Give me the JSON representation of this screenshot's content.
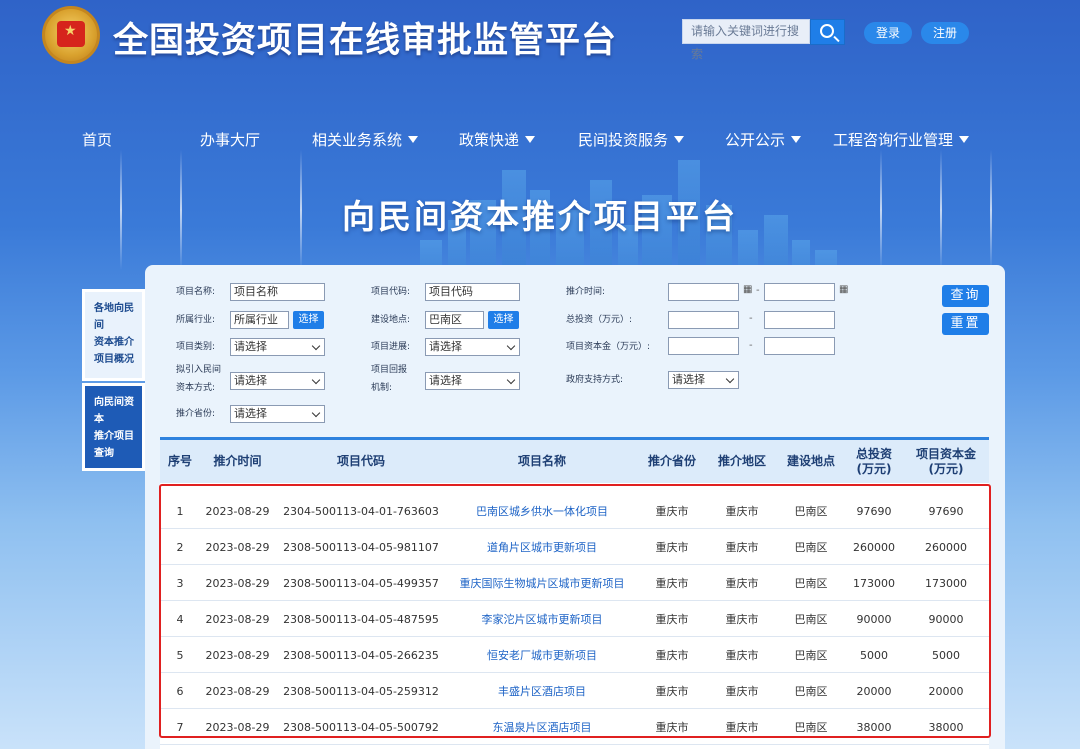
{
  "header": {
    "site_title": "全国投资项目在线审批监管平台",
    "search_placeholder": "请输入关键词进行搜索",
    "login": "登录",
    "register": "注册"
  },
  "nav": [
    "首页",
    "办事大厅",
    "相关业务系统",
    "政策快递",
    "民间投资服务",
    "公开公示",
    "工程咨询行业管理"
  ],
  "banner_title": "向民间资本推介项目平台",
  "side_tabs": [
    [
      "各地向民间",
      "资本推介",
      "项目概况"
    ],
    [
      "向民间资本",
      "推介项目",
      "查询"
    ]
  ],
  "form": {
    "project_name_label": "项目名称:",
    "project_name_value": "项目名称",
    "industry_label": "所属行业:",
    "industry_value": "所属行业",
    "category_label": "项目类别:",
    "category_value": "请选择",
    "attract_label_1": "拟引入民间",
    "attract_label_2": "资本方式:",
    "attract_value": "请选择",
    "province_label": "推介省份:",
    "province_value": "请选择",
    "code_label": "项目代码:",
    "code_value": "项目代码",
    "location_label": "建设地点:",
    "location_value": "巴南区",
    "progress_label": "项目进展:",
    "progress_value": "请选择",
    "return_label_1": "项目回报",
    "return_label_2": "机制:",
    "return_value": "请选择",
    "date_label": "推介时间:",
    "total_label": "总投资（万元）:",
    "capital_label": "项目资本金（万元）:",
    "gov_label": "政府支持方式:",
    "gov_value": "请选择",
    "pick": "选择",
    "dash": "-",
    "query": "查询",
    "reset": "重置"
  },
  "table": {
    "headers": [
      "序号",
      "推介时间",
      "项目代码",
      "项目名称",
      "推介省份",
      "推介地区",
      "建设地点",
      "总投资\n(万元)",
      "项目资本金\n(万元)"
    ],
    "rows": [
      [
        "1",
        "2023-08-29",
        "2304-500113-04-01-763603",
        "巴南区城乡供水一体化项目",
        "重庆市",
        "重庆市",
        "巴南区",
        "97690",
        "97690"
      ],
      [
        "2",
        "2023-08-29",
        "2308-500113-04-05-981107",
        "道角片区城市更新项目",
        "重庆市",
        "重庆市",
        "巴南区",
        "260000",
        "260000"
      ],
      [
        "3",
        "2023-08-29",
        "2308-500113-04-05-499357",
        "重庆国际生物城片区城市更新项目",
        "重庆市",
        "重庆市",
        "巴南区",
        "173000",
        "173000"
      ],
      [
        "4",
        "2023-08-29",
        "2308-500113-04-05-487595",
        "李家沱片区城市更新项目",
        "重庆市",
        "重庆市",
        "巴南区",
        "90000",
        "90000"
      ],
      [
        "5",
        "2023-08-29",
        "2308-500113-04-05-266235",
        "恒安老厂城市更新项目",
        "重庆市",
        "重庆市",
        "巴南区",
        "5000",
        "5000"
      ],
      [
        "6",
        "2023-08-29",
        "2308-500113-04-05-259312",
        "丰盛片区酒店项目",
        "重庆市",
        "重庆市",
        "巴南区",
        "20000",
        "20000"
      ],
      [
        "7",
        "2023-08-29",
        "2308-500113-04-05-500792",
        "东温泉片区酒店项目",
        "重庆市",
        "重庆市",
        "巴南区",
        "38000",
        "38000"
      ]
    ]
  }
}
